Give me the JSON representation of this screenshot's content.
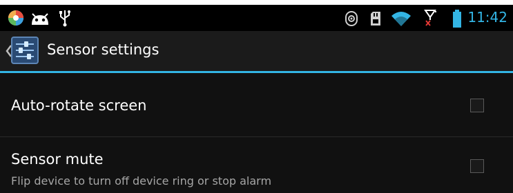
{
  "status_bar": {
    "time": "11:42",
    "left_icons": [
      "app-store-icon",
      "android-debug-icon",
      "usb-icon"
    ],
    "right_icons": [
      "sync-icon",
      "sd-card-icon",
      "wifi-icon",
      "no-signal-icon",
      "battery-icon"
    ]
  },
  "action_bar": {
    "title": "Sensor settings",
    "app_icon": "sliders-settings-icon"
  },
  "settings": {
    "auto_rotate": {
      "title": "Auto-rotate screen",
      "checked": false
    },
    "sensor_mute": {
      "title": "Sensor mute",
      "summary": "Flip device to turn off device ring or stop alarm",
      "checked": false
    }
  },
  "colors": {
    "accent": "#33b5e5",
    "background": "#111111",
    "action_bar": "#1b1b1b",
    "summary_text": "#a6a6a6"
  }
}
